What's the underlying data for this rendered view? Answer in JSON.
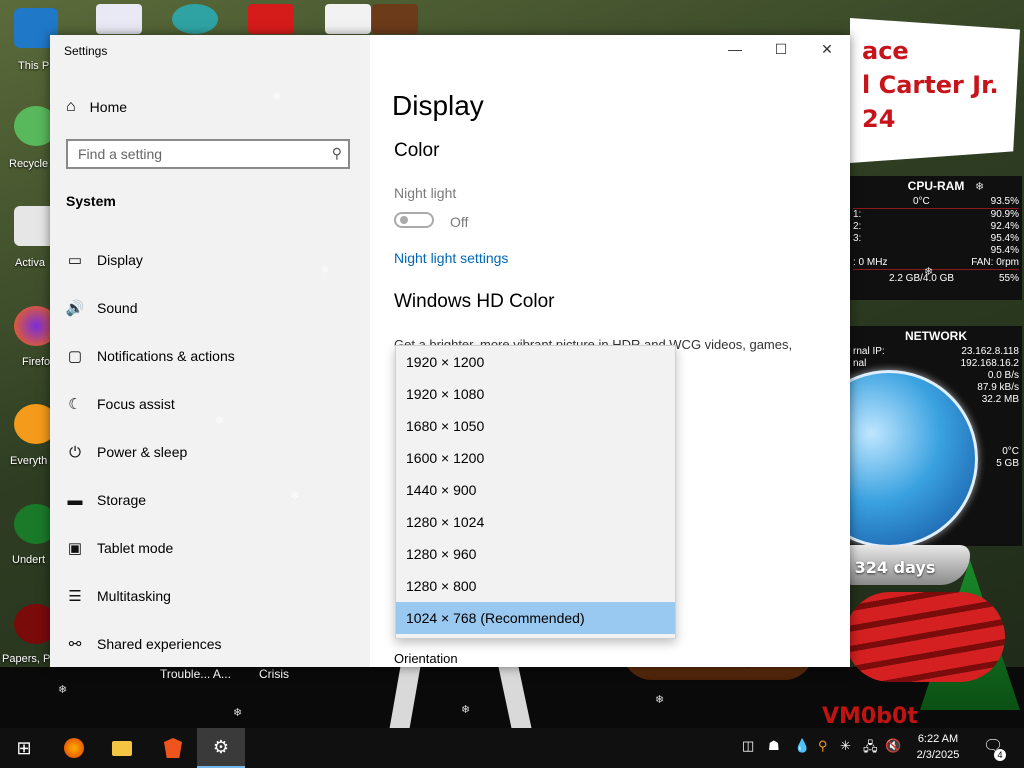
{
  "desktop": {
    "icons": [
      {
        "label": "This P"
      },
      {
        "label": "Recycle"
      },
      {
        "label": "Activa"
      },
      {
        "label": "Firefo"
      },
      {
        "label": "Everyth"
      },
      {
        "label": "Undert"
      },
      {
        "label": "Papers, P"
      }
    ],
    "banner": {
      "line1": "ace",
      "line2": "l Carter Jr.",
      "line3": "24"
    },
    "task_labels": [
      "Trouble... A...",
      "Crisis"
    ]
  },
  "cpu_widget": {
    "title": "CPU-RAM",
    "temp": "0°C",
    "total": "93.5%",
    "rows": [
      {
        "l": "1:",
        "r": "90.9%"
      },
      {
        "l": "2:",
        "r": "92.4%"
      },
      {
        "l": "3:",
        "r": "95.4%"
      },
      {
        "l": "",
        "r": "95.4%"
      }
    ],
    "freq": ": 0 MHz",
    "fan": "FAN: 0rpm",
    "ram": "2.2 GB/4.0 GB",
    "ram_pct": "55%"
  },
  "net_widget": {
    "title": "NETWORK",
    "rows": [
      {
        "l": "rnal IP:",
        "r": "23.162.8.118"
      },
      {
        "l": "nal",
        "r": "192.168.16.2"
      },
      {
        "l": "",
        "r": "0.0 B/s"
      },
      {
        "l": "",
        "r": "87.9 kB/s"
      },
      {
        "l": "",
        "r": "32.2 MB"
      }
    ],
    "extra": [
      {
        "r": "0°C"
      },
      {
        "r": "5 GB"
      }
    ]
  },
  "globes": {
    "left_days": "324 days",
    "right_days": "324 days",
    "sign": "VM0b0t"
  },
  "settings": {
    "window_title": "Settings",
    "home_label": "Home",
    "search_placeholder": "Find a setting",
    "section_label": "System",
    "nav": [
      {
        "label": "Display",
        "icon": "monitor-icon",
        "glyph": "▭"
      },
      {
        "label": "Sound",
        "icon": "speaker-icon",
        "glyph": "🔊"
      },
      {
        "label": "Notifications & actions",
        "icon": "notification-icon",
        "glyph": "▢"
      },
      {
        "label": "Focus assist",
        "icon": "moon-icon",
        "glyph": "☾"
      },
      {
        "label": "Power & sleep",
        "icon": "power-icon",
        "glyph": "⏻"
      },
      {
        "label": "Storage",
        "icon": "storage-icon",
        "glyph": "▬"
      },
      {
        "label": "Tablet mode",
        "icon": "tablet-icon",
        "glyph": "▣"
      },
      {
        "label": "Multitasking",
        "icon": "multitasking-icon",
        "glyph": "☰"
      },
      {
        "label": "Shared experiences",
        "icon": "shared-icon",
        "glyph": "⚯"
      }
    ],
    "page_title": "Display",
    "color_heading": "Color",
    "night_light_label": "Night light",
    "night_light_state": "Off",
    "night_light_link": "Night light settings",
    "hd_color_heading": "Windows HD Color",
    "hd_color_desc": "Get a brighter, more vibrant picture in HDR and WCG videos, games,",
    "resolutions": [
      "1920 × 1200",
      "1920 × 1080",
      "1680 × 1050",
      "1600 × 1200",
      "1440 × 900",
      "1280 × 1024",
      "1280 × 960",
      "1280 × 800",
      "1024 × 768 (Recommended)"
    ],
    "selected_resolution": "1024 × 768 (Recommended)",
    "orientation_label": "Orientation"
  },
  "taskbar": {
    "time": "6:22 AM",
    "date": "2/3/2025",
    "notification_count": "4"
  }
}
